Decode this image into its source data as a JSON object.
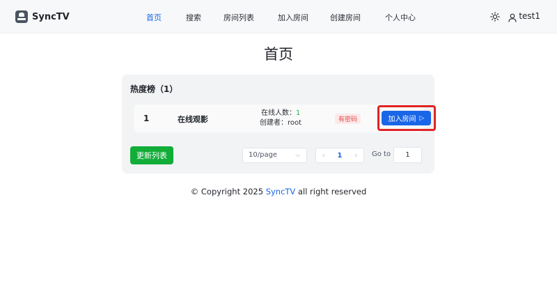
{
  "header": {
    "logo_text": "SyncTV",
    "nav": [
      {
        "label": "首页",
        "active": true
      },
      {
        "label": "搜索",
        "active": false
      },
      {
        "label": "房间列表",
        "active": false
      },
      {
        "label": "加入房间",
        "active": false
      },
      {
        "label": "创建房间",
        "active": false
      },
      {
        "label": "个人中心",
        "active": false
      }
    ],
    "username": "test1",
    "icons": [
      "sun-icon",
      "user-icon"
    ]
  },
  "page": {
    "title": "首页"
  },
  "hot_list": {
    "title": "热度榜（1）",
    "rooms": [
      {
        "rank": "1",
        "name": "在线观影",
        "online_label": "在线人数：",
        "online_count": "1",
        "creator_label": "创建者：",
        "creator": "root",
        "badge": "有密码",
        "join_label": "加入房间",
        "join_icon": "play-icon"
      }
    ],
    "refresh_label": "更新列表",
    "page_size": "10/page",
    "current_page": "1",
    "goto_label": "Go to",
    "goto_value": "1"
  },
  "footer": {
    "prefix": "© Copyright 2025 ",
    "brand": "SyncTV",
    "suffix": " all right reserved"
  },
  "colors": {
    "accent": "#1a66e8",
    "success": "#11ad38",
    "highlight": "#e02424",
    "badge_text": "#e24b4b"
  }
}
